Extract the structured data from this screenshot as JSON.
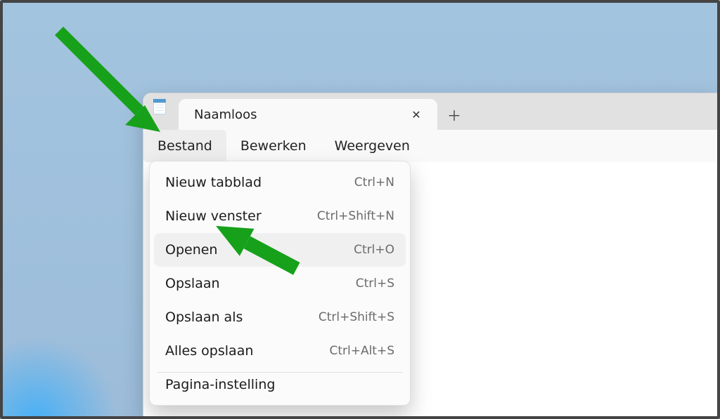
{
  "tab": {
    "title": "Naamloos"
  },
  "menubar": {
    "file": "Bestand",
    "edit": "Bewerken",
    "view": "Weergeven"
  },
  "menu": {
    "items": [
      {
        "label": "Nieuw tabblad",
        "shortcut": "Ctrl+N"
      },
      {
        "label": "Nieuw venster",
        "shortcut": "Ctrl+Shift+N"
      },
      {
        "label": "Openen",
        "shortcut": "Ctrl+O"
      },
      {
        "label": "Opslaan",
        "shortcut": "Ctrl+S"
      },
      {
        "label": "Opslaan als",
        "shortcut": "Ctrl+Shift+S"
      },
      {
        "label": "Alles opslaan",
        "shortcut": "Ctrl+Alt+S"
      }
    ],
    "next_section_first": "Pagina-instelling"
  },
  "colors": {
    "arrow": "#17a11b"
  }
}
